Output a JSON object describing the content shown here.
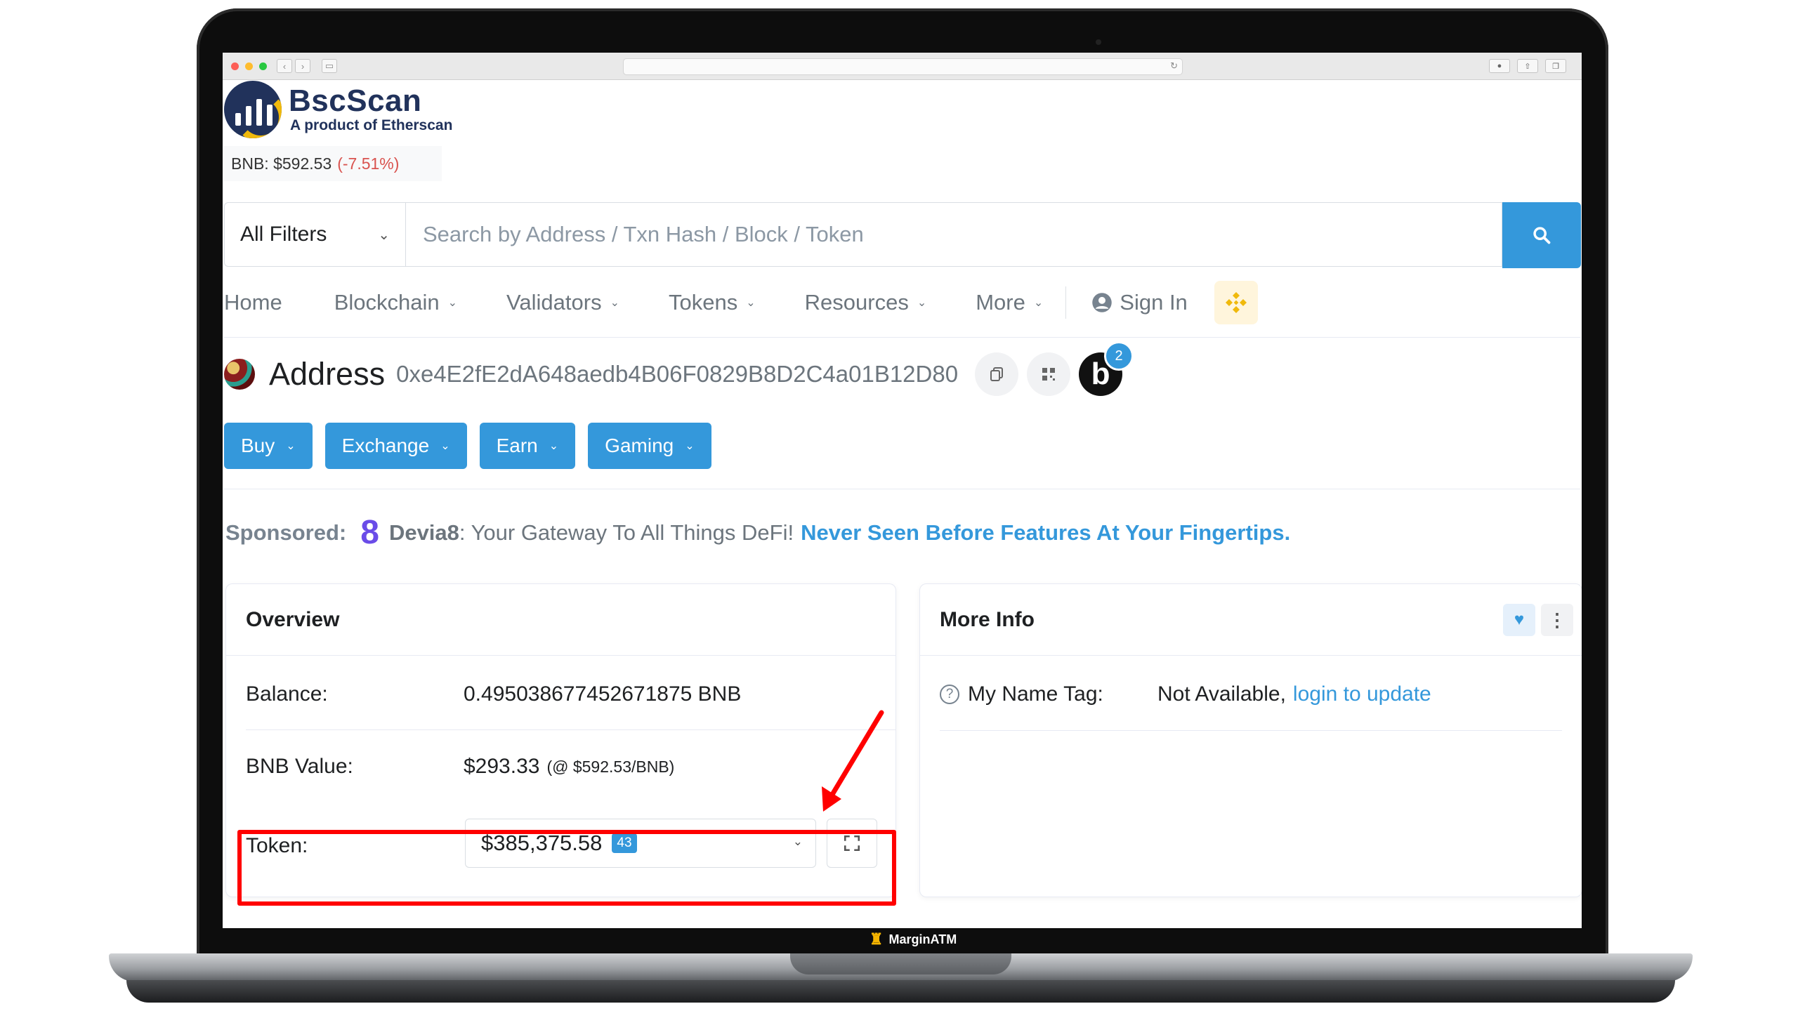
{
  "brand": {
    "name": "BscScan",
    "subtitle": "A product of Etherscan",
    "footer_label": "MarginATM"
  },
  "price": {
    "label": "BNB: $592.53",
    "change": "(-7.51%)"
  },
  "search": {
    "filter_label": "All Filters",
    "placeholder": "Search by Address / Txn Hash / Block / Token"
  },
  "nav": {
    "items": [
      "Home",
      "Blockchain",
      "Validators",
      "Tokens",
      "Resources",
      "More"
    ],
    "sign_in": "Sign In"
  },
  "address": {
    "title": "Address",
    "hash": "0xe4E2fE2dA648aedb4B06F0829B8D2C4a01B12D80",
    "badge_letter": "b",
    "badge_count": "2"
  },
  "actions": [
    "Buy",
    "Exchange",
    "Earn",
    "Gaming"
  ],
  "sponsored": {
    "label": "Sponsored:",
    "brand": "Devia8",
    "text": ": Your Gateway To All Things DeFi!",
    "cta": "Never Seen Before Features At Your Fingertips."
  },
  "overview": {
    "title": "Overview",
    "balance_label": "Balance:",
    "balance_value": "0.495038677452671875 BNB",
    "value_label": "BNB Value:",
    "value_amount": "$293.33",
    "value_rate": "(@ $592.53/BNB)",
    "token_label": "Token:",
    "token_value": "$385,375.58",
    "token_count": "43"
  },
  "more_info": {
    "title": "More Info",
    "name_tag_label": "My Name Tag:",
    "name_tag_value": "Not Available,",
    "name_tag_link": "login to update"
  },
  "colors": {
    "accent": "#3498db",
    "annotation": "#ff0000",
    "negative": "#d9534f"
  }
}
